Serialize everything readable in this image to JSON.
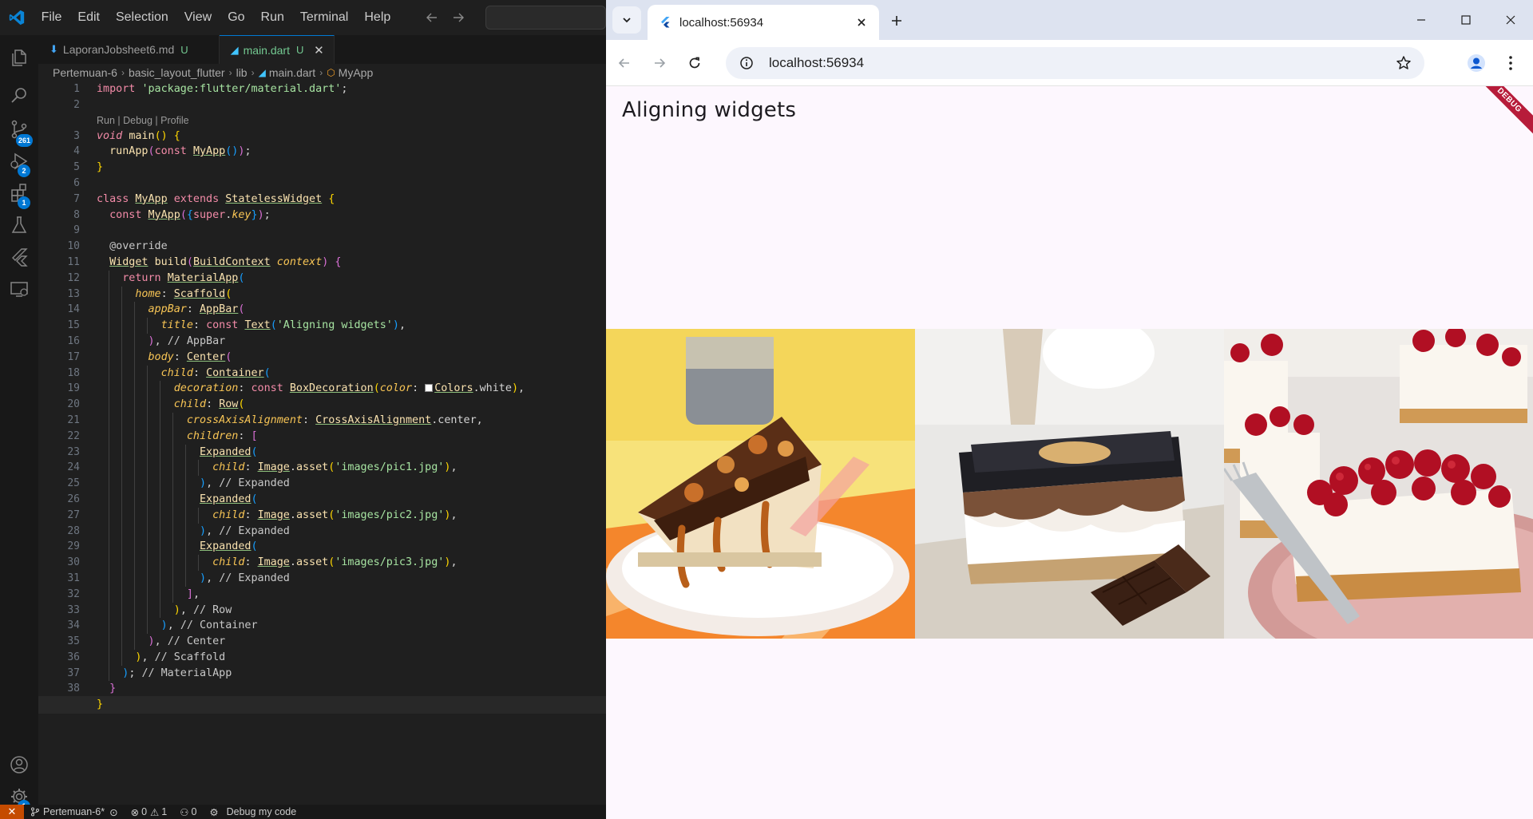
{
  "vscode": {
    "menu": [
      "File",
      "Edit",
      "Selection",
      "View",
      "Go",
      "Run",
      "Terminal",
      "Help"
    ],
    "activity_badges": {
      "source_control": "261",
      "run_debug": "2",
      "extensions": "1",
      "settings": "1"
    },
    "tabs": [
      {
        "label": "LaporanJobsheet6.md",
        "status": "U",
        "icon": "markdown-icon"
      },
      {
        "label": "main.dart",
        "status": "U",
        "icon": "dart-icon",
        "active": true
      }
    ],
    "breadcrumb": [
      "Pertemuan-6",
      "basic_layout_flutter",
      "lib",
      "main.dart",
      "MyApp"
    ],
    "codelens": "Run | Debug | Profile",
    "status": {
      "branch": "Pertemuan-6*",
      "errors": "0",
      "warnings": "1",
      "ports": "0",
      "debug": "Debug my code"
    }
  },
  "browser": {
    "tab_title": "localhost:56934",
    "url": "localhost:56934",
    "app_title": "Aligning widgets",
    "debug_banner": "DEBUG",
    "images": [
      "pic1.jpg",
      "pic2.jpg",
      "pic3.jpg"
    ]
  },
  "colors": {
    "vscode_bg": "#1f1f1f",
    "accent": "#0078d4",
    "browser_bg": "#fdf7fe",
    "debug_banner": "#b71c3a"
  }
}
